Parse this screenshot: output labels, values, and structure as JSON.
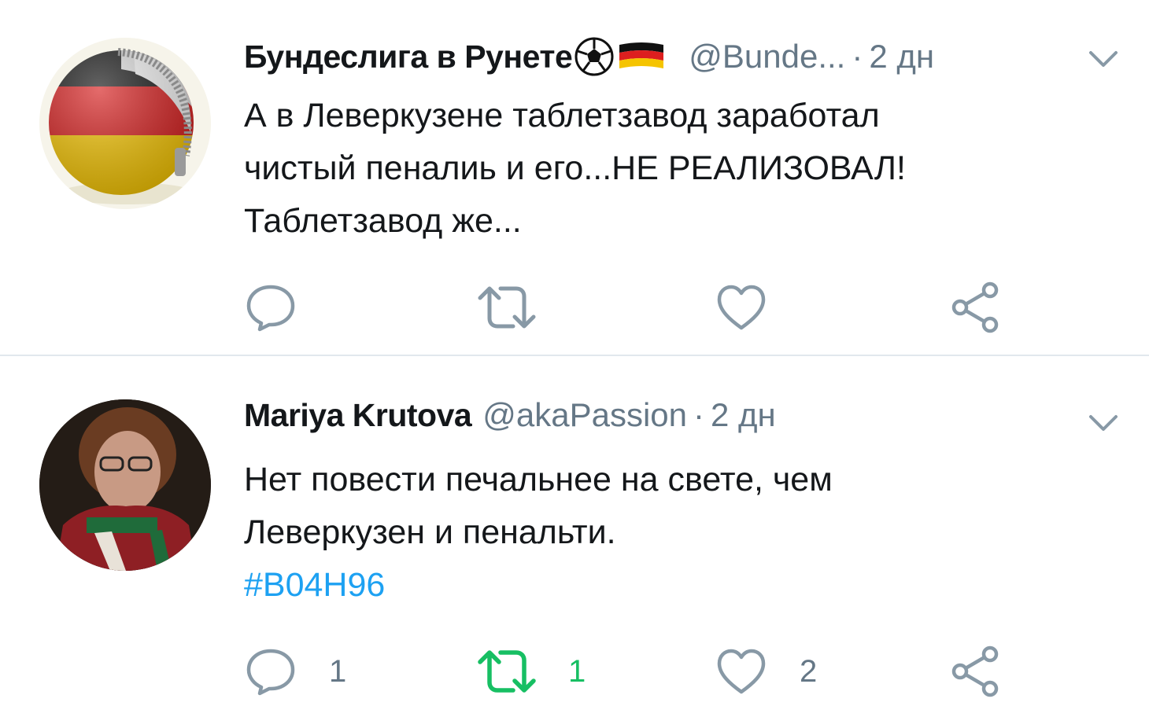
{
  "tweets": [
    {
      "display_name": "Бундеслига в Рунете",
      "emoji": [
        "soccer-ball-icon",
        "german-flag-icon"
      ],
      "handle": "@Bunde...",
      "separator": "·",
      "time": "2 дн",
      "lines": [
        "А в Леверкузене таблетзавод заработал",
        "чистый пеналиь и его...НЕ РЕАЛИЗОВАЛ!",
        "Таблетзавод же..."
      ],
      "hashtag": "",
      "counts": {
        "reply": "",
        "retweet": "",
        "like": ""
      },
      "retweeted": false
    },
    {
      "display_name": "Mariya Krutova",
      "emoji": [],
      "handle": "@akaPassion",
      "separator": "·",
      "time": "2 дн",
      "lines": [
        "Нет повести печальнее на свете, чем",
        "Леверкузен и пенальти."
      ],
      "hashtag": "#B04H96",
      "counts": {
        "reply": "1",
        "retweet": "1",
        "like": "2"
      },
      "retweeted": true
    }
  ],
  "colors": {
    "text": "#14171a",
    "secondary": "#657786",
    "link": "#1da1f2",
    "retweet_active": "#17bf63",
    "divider": "#e1e8ed"
  },
  "icons": {
    "reply": "reply-icon",
    "retweet": "retweet-icon",
    "like": "like-icon",
    "share": "share-icon",
    "caret": "chevron-down-icon"
  }
}
